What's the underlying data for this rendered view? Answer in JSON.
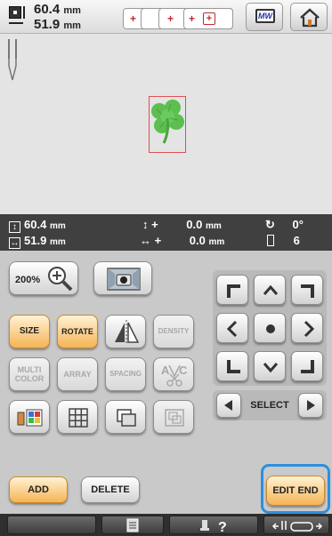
{
  "header": {
    "width_value": "60.4",
    "height_value": "51.9",
    "unit": "mm",
    "hoop_markers": [
      "+",
      "+",
      "+",
      "+"
    ],
    "monitor_label": "MW"
  },
  "info": {
    "height_value": "60.4",
    "width_value": "51.9",
    "unit": "mm",
    "vertical_offset": "0.0",
    "horizontal_offset": "0.0",
    "offset_prefix": "+",
    "rotation": "0°",
    "color_count": "6"
  },
  "buttons": {
    "zoom": "200%",
    "size": "SIZE",
    "rotate": "ROTATE",
    "density": "DENSITY",
    "multi_color": "MULTI COLOR",
    "array": "ARRAY",
    "spacing": "SPACING",
    "select": "SELECT",
    "add": "ADD",
    "delete": "DELETE",
    "edit_end": "EDIT END"
  },
  "colors": {
    "accent_orange": "#f5b455",
    "highlight_blue": "#2e8fdc",
    "clover_green": "#5cbf4f",
    "frame_red": "#e05050"
  }
}
